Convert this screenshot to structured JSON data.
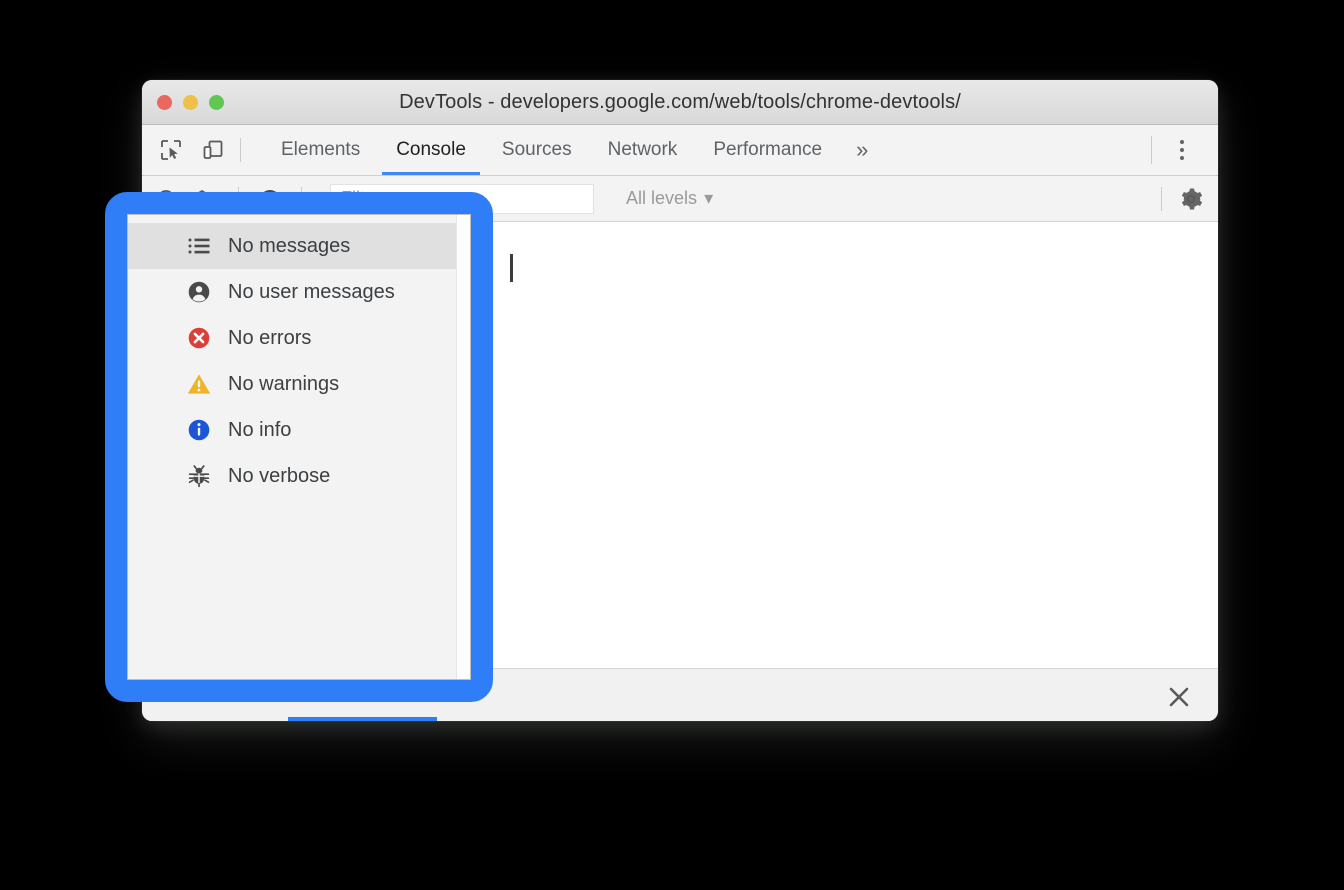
{
  "window": {
    "title": "DevTools - developers.google.com/web/tools/chrome-devtools/",
    "traffic_lights": [
      {
        "name": "close",
        "color": "#e8695f"
      },
      {
        "name": "minimize",
        "color": "#eec04a"
      },
      {
        "name": "maximize",
        "color": "#60c654"
      }
    ]
  },
  "tabbar": {
    "inspect_icon": "inspect-element-icon",
    "device_icon": "device-toolbar-icon",
    "tabs": [
      {
        "label": "Elements",
        "active": false
      },
      {
        "label": "Console",
        "active": true
      },
      {
        "label": "Sources",
        "active": false
      },
      {
        "label": "Network",
        "active": false
      },
      {
        "label": "Performance",
        "active": false
      }
    ],
    "more_tabs_label": "»",
    "main_menu_icon": "kebab-menu-icon",
    "active_underline_color": "#4285f4"
  },
  "console_toolbar": {
    "clear_icon": "clear-console-icon",
    "context_icon": "execution-context-icon",
    "context_caret": "▾",
    "eye_icon": "live-expression-eye-icon",
    "filter_placeholder": "Filter",
    "filter_value": "",
    "levels_label": "All levels",
    "levels_caret": "▾",
    "settings_icon": "gear-icon"
  },
  "console_body": {
    "prompt_caret": "text-cursor"
  },
  "bottom_bar": {
    "close_icon": "close-drawer-icon",
    "accent_color": "#2f7ef7"
  },
  "filter_dropdown": {
    "highlight_color": "#2f7ef7",
    "items": [
      {
        "label": "No messages",
        "icon": "list-icon",
        "selected": true
      },
      {
        "label": "No user messages",
        "icon": "person-icon",
        "selected": false
      },
      {
        "label": "No errors",
        "icon": "error-icon",
        "selected": false
      },
      {
        "label": "No warnings",
        "icon": "warning-icon",
        "selected": false
      },
      {
        "label": "No info",
        "icon": "info-icon",
        "selected": false
      },
      {
        "label": "No verbose",
        "icon": "bug-icon",
        "selected": false
      }
    ]
  }
}
